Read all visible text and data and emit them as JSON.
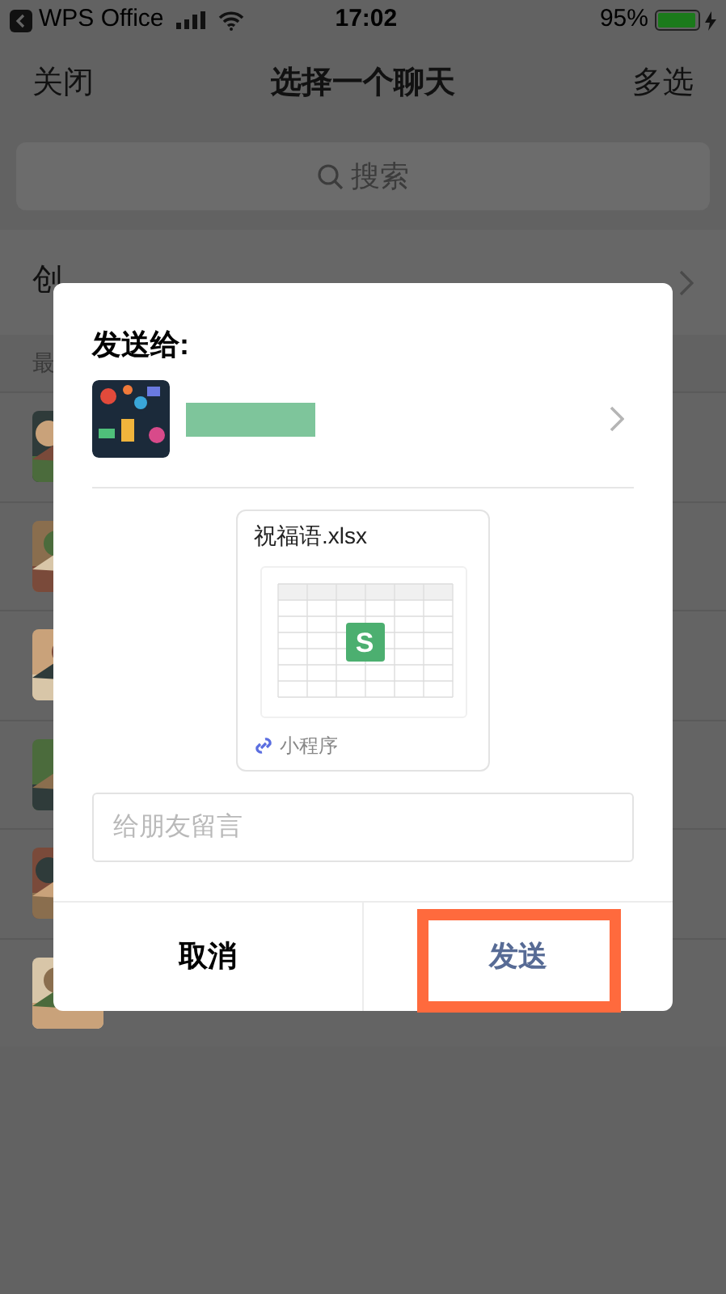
{
  "status_bar": {
    "app_back": "WPS Office",
    "time": "17:02",
    "battery": "95%"
  },
  "nav": {
    "left": "关闭",
    "title": "选择一个聊天",
    "right": "多选"
  },
  "search": {
    "placeholder": "搜索"
  },
  "create_chat": "创",
  "section_header": "最",
  "dialog": {
    "title": "发送给:",
    "file_card": {
      "file_name": "祝福语.xlsx",
      "logo_letter": "S",
      "source": "小程序"
    },
    "message": {
      "placeholder": "给朋友留言"
    },
    "buttons": [
      {
        "label": "取消",
        "kind": "cancel",
        "highlighted": false
      },
      {
        "label": "发送",
        "kind": "send",
        "highlighted": true
      }
    ]
  }
}
